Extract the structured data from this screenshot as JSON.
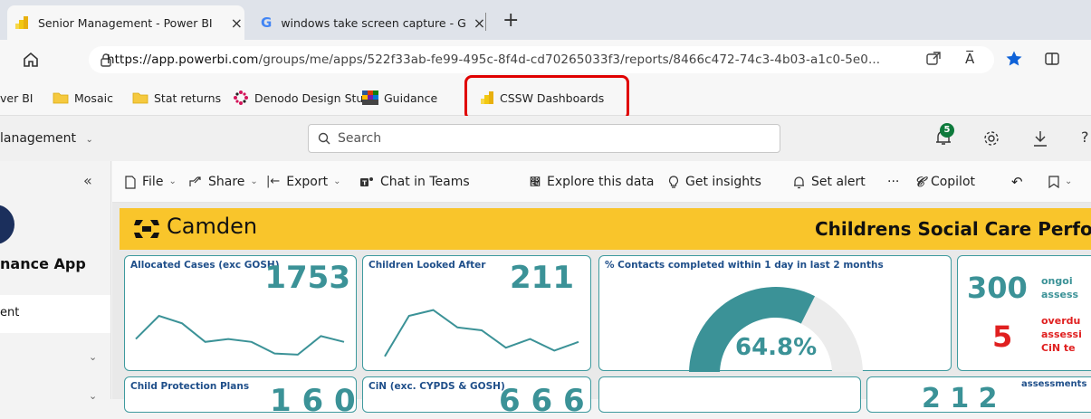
{
  "tabs": [
    {
      "title": "Senior Management - Power BI",
      "close": "×"
    },
    {
      "title": "windows take screen capture - G",
      "close": "×"
    }
  ],
  "new_tab": "+",
  "address": {
    "url_host": "https://app.powerbi.com",
    "url_path": "/groups/me/apps/522f33ab-fe99-495c-8f4d-cd70265033f3/reports/8466c472-74c3-4b03-a1c0-5e0...",
    "read_aloud": "A̅"
  },
  "favorites": [
    {
      "label": "ver BI"
    },
    {
      "label": "Mosaic"
    },
    {
      "label": "Stat returns"
    },
    {
      "label": "Denodo Design Stu..."
    },
    {
      "label": "Guidance"
    },
    {
      "label": "CSSW Dashboards"
    }
  ],
  "pbi_header": {
    "workspace": "lanagement",
    "search_placeholder": "Search",
    "notification_count": "5"
  },
  "left_nav": {
    "collapse": "«",
    "app_name": "nance App",
    "item": "ent"
  },
  "toolbar": {
    "file": "File",
    "share": "Share",
    "export": "Export",
    "chat": "Chat in Teams",
    "explore": "Explore this data",
    "insights": "Get insights",
    "alert": "Set alert",
    "more": "···",
    "copilot": "Copilot"
  },
  "report": {
    "brand": "Camden",
    "title": "Childrens Social Care Perfo",
    "cards": [
      {
        "title": "Allocated Cases (exc GOSH)",
        "value": "1753"
      },
      {
        "title": "Children Looked After",
        "value": "211"
      },
      {
        "title": "% Contacts completed within 1 day in last 2 months",
        "value": "64.8%"
      },
      {
        "value_a": "300",
        "label_a1": "ongoi",
        "label_a2": "assess",
        "value_b": "5",
        "label_b1": "overdu",
        "label_b2": "assessi",
        "label_b3": "CiN te"
      }
    ],
    "row2": [
      {
        "title": "Child Protection Plans"
      },
      {
        "title": "CiN (exc. CYPDS & GOSH)"
      },
      {
        "label": "assessments"
      }
    ],
    "gauge_fraction": 0.648
  },
  "chart_data": [
    {
      "type": "line",
      "title": "Allocated Cases (exc GOSH)",
      "values": [
        0.35,
        0.75,
        0.62,
        0.3,
        0.35,
        0.3,
        0.1,
        0.08,
        0.4,
        0.3
      ]
    },
    {
      "type": "line",
      "title": "Children Looked After",
      "values": [
        0.05,
        0.75,
        0.85,
        0.55,
        0.5,
        0.2,
        0.35,
        0.15,
        0.3
      ]
    }
  ],
  "colors": {
    "accent_teal": "#3b9297",
    "banner_yellow": "#f9c52b",
    "alert_red": "#e02020",
    "title_blue": "#1f4f8a"
  }
}
